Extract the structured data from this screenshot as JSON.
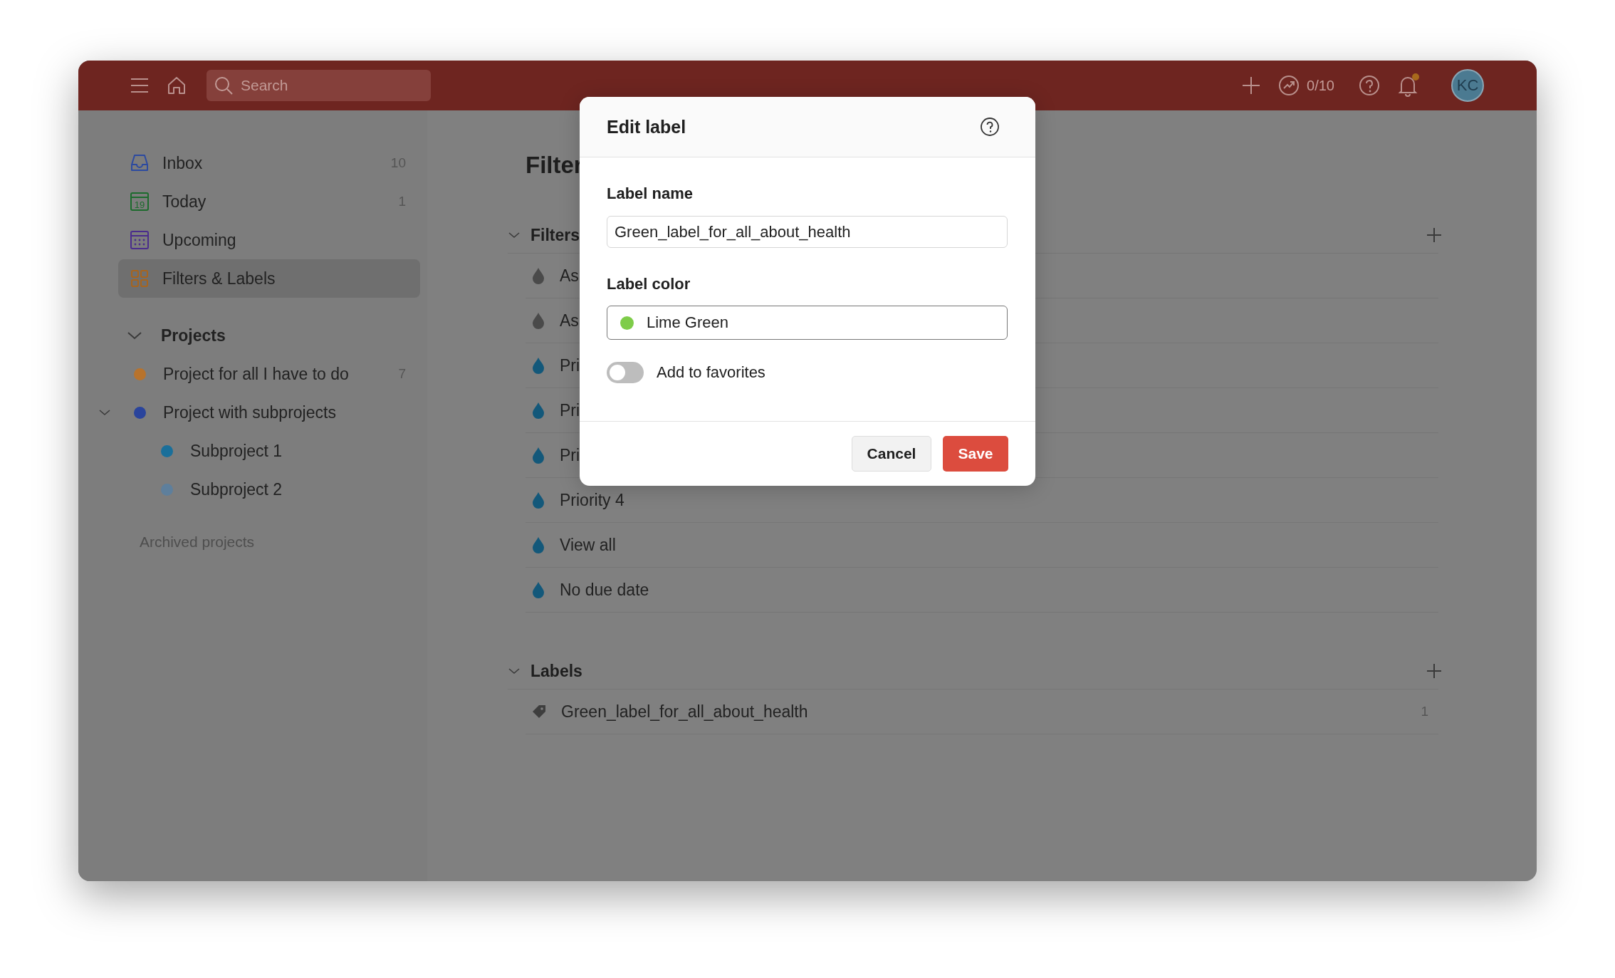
{
  "topbar": {
    "search": {
      "placeholder": "Search"
    },
    "karma": "0/10",
    "avatar": "KC"
  },
  "sidebar": {
    "nav": [
      {
        "kind": "inbox",
        "label": "Inbox",
        "count": "10",
        "selected": false
      },
      {
        "kind": "today",
        "label": "Today",
        "count": "1",
        "icon_label": "19",
        "selected": false
      },
      {
        "kind": "upcoming",
        "label": "Upcoming",
        "selected": false
      },
      {
        "kind": "filters",
        "label": "Filters & Labels",
        "selected": true
      }
    ],
    "projects_heading": "Projects",
    "projects": [
      {
        "name": "Project for all I have to do",
        "count": "7",
        "color": "#b8732c"
      },
      {
        "name": "Project with subprojects",
        "color": "#2a449c",
        "expanded": true,
        "children": [
          {
            "name": "Subproject 1",
            "color": "#1a6f9a"
          },
          {
            "name": "Subproject 2",
            "color": "#5e7f9c"
          }
        ]
      }
    ],
    "archived": "Archived projects"
  },
  "main": {
    "title": "Filter",
    "filters": {
      "heading": "Filters",
      "items": [
        {
          "label": "As",
          "color": "#4a4a4a"
        },
        {
          "label": "As",
          "color": "#4a4a4a"
        },
        {
          "label": "Pri",
          "color": "#13587a"
        },
        {
          "label": "Pri",
          "color": "#13587a"
        },
        {
          "label": "Pri",
          "color": "#13587a"
        },
        {
          "label": "Priority 4",
          "color": "#13587a"
        },
        {
          "label": "View all",
          "color": "#13587a"
        },
        {
          "label": "No due date",
          "color": "#13587a"
        }
      ]
    },
    "labels": {
      "heading": "Labels",
      "items": [
        {
          "name": "Green_label_for_all_about_health",
          "count": "1"
        }
      ]
    }
  },
  "dialog": {
    "title": "Edit label",
    "name_label": "Label name",
    "name_value": "Green_label_for_all_about_health",
    "color_label": "Label color",
    "color_value": "Lime Green",
    "color": "#7ecc49",
    "favorites": {
      "label": "Add to favorites",
      "on": false
    },
    "cancel": "Cancel",
    "save": "Save"
  }
}
